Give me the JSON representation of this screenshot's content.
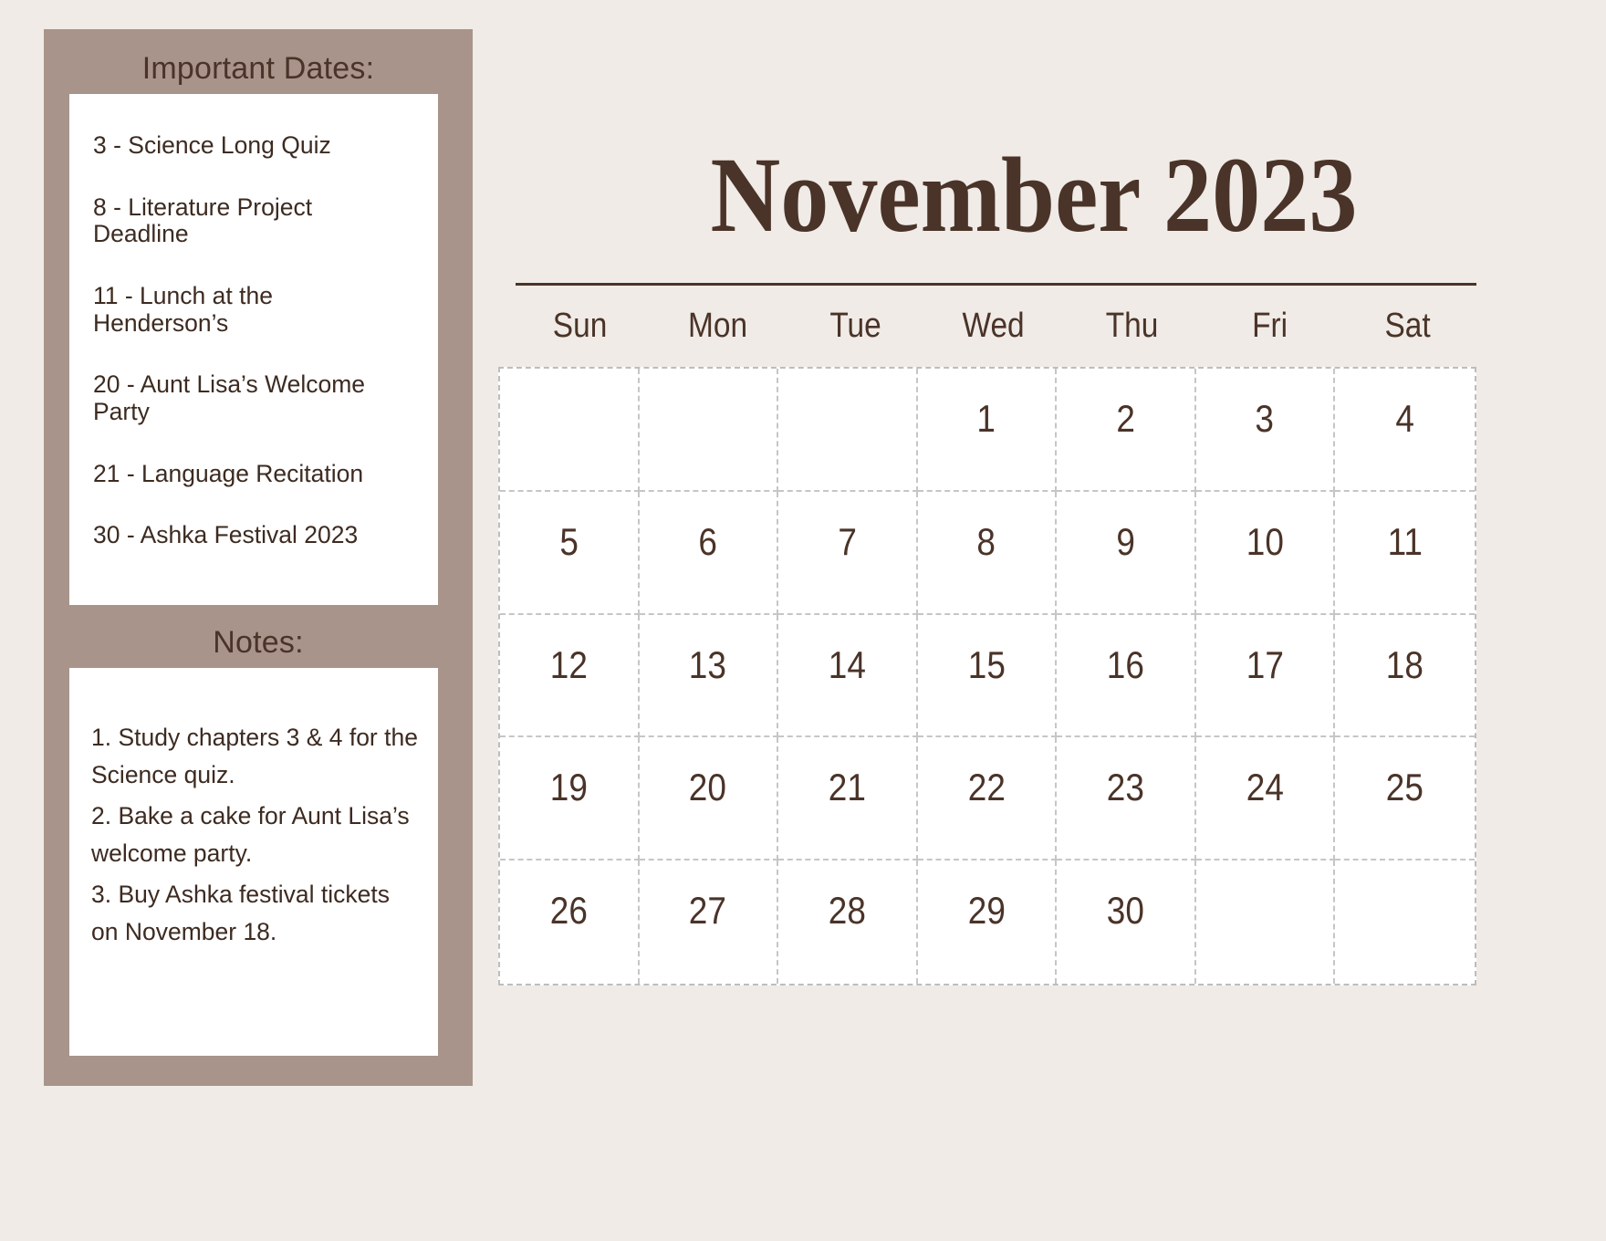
{
  "sidebar": {
    "dates_heading": "Important Dates:",
    "notes_heading": "Notes:",
    "important_dates": [
      "3 - Science Long Quiz",
      "8 -  Literature Project Deadline",
      "11 - Lunch at the Henderson’s",
      "20 - Aunt Lisa’s Welcome Party",
      "21 -  Language Recitation",
      "30 - Ashka Festival 2023"
    ],
    "notes": [
      "1. Study chapters 3 & 4 for the Science quiz.",
      "2. Bake a cake for Aunt Lisa’s welcome party.",
      "3. Buy Ashka festival tickets on November 18."
    ]
  },
  "calendar": {
    "title": "November 2023",
    "month": "November",
    "year": "2023",
    "weekdays": [
      "Sun",
      "Mon",
      "Tue",
      "Wed",
      "Thu",
      "Fri",
      "Sat"
    ],
    "first_weekday_index": 3,
    "days_in_month": 30,
    "weeks": [
      [
        "",
        "",
        "",
        "1",
        "2",
        "3",
        "4"
      ],
      [
        "5",
        "6",
        "7",
        "8",
        "9",
        "10",
        "11"
      ],
      [
        "12",
        "13",
        "14",
        "15",
        "16",
        "17",
        "18"
      ],
      [
        "19",
        "20",
        "21",
        "22",
        "23",
        "24",
        "25"
      ],
      [
        "26",
        "27",
        "28",
        "29",
        "30",
        "",
        ""
      ]
    ]
  },
  "colors": {
    "background": "#f0ebe6",
    "sidebar": "#a8948a",
    "panel": "#ffffff",
    "text_dark": "#4a3328",
    "grid_line": "#c6c6c6"
  }
}
